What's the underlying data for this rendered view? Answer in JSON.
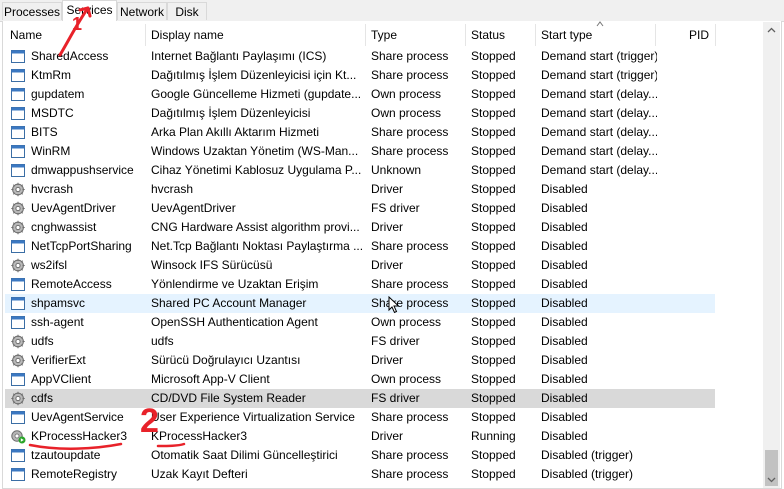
{
  "tabs": [
    {
      "label": "Processes",
      "active": false
    },
    {
      "label": "Services",
      "active": true
    },
    {
      "label": "Network",
      "active": false
    },
    {
      "label": "Disk",
      "active": false
    }
  ],
  "columns": {
    "name": "Name",
    "display_name": "Display name",
    "type": "Type",
    "status": "Status",
    "start_type": "Start type",
    "pid": "PID"
  },
  "rows": [
    {
      "icon": "service-window-icon",
      "name": "SharedAccess",
      "display": "Internet Bağlantı Paylaşımı (ICS)",
      "type": "Share process",
      "status": "Stopped",
      "start": "Demand start (trigger)",
      "pid": ""
    },
    {
      "icon": "service-window-icon",
      "name": "KtmRm",
      "display": "Dağıtılmış İşlem Düzenleyicisi için Kt...",
      "type": "Share process",
      "status": "Stopped",
      "start": "Demand start (trigger)",
      "pid": ""
    },
    {
      "icon": "service-window-icon",
      "name": "gupdatem",
      "display": "Google Güncelleme Hizmeti (gupdate...",
      "type": "Own process",
      "status": "Stopped",
      "start": "Demand start (delay...",
      "pid": ""
    },
    {
      "icon": "service-window-icon",
      "name": "MSDTC",
      "display": "Dağıtılmış İşlem Düzenleyicisi",
      "type": "Own process",
      "status": "Stopped",
      "start": "Demand start (delay...",
      "pid": ""
    },
    {
      "icon": "service-window-icon",
      "name": "BITS",
      "display": "Arka Plan Akıllı Aktarım Hizmeti",
      "type": "Share process",
      "status": "Stopped",
      "start": "Demand start (delay...",
      "pid": ""
    },
    {
      "icon": "service-window-icon",
      "name": "WinRM",
      "display": "Windows Uzaktan Yönetim (WS-Man...",
      "type": "Share process",
      "status": "Stopped",
      "start": "Demand start (delay...",
      "pid": ""
    },
    {
      "icon": "service-window-icon",
      "name": "dmwappushservice",
      "display": "Cihaz Yönetimi Kablosuz Uygulama P...",
      "type": "Unknown",
      "status": "Stopped",
      "start": "Demand start (delay...",
      "pid": ""
    },
    {
      "icon": "driver-gear-icon",
      "name": "hvcrash",
      "display": "hvcrash",
      "type": "Driver",
      "status": "Stopped",
      "start": "Disabled",
      "pid": ""
    },
    {
      "icon": "driver-gear-icon",
      "name": "UevAgentDriver",
      "display": "UevAgentDriver",
      "type": "FS driver",
      "status": "Stopped",
      "start": "Disabled",
      "pid": ""
    },
    {
      "icon": "driver-gear-icon",
      "name": "cnghwassist",
      "display": "CNG Hardware Assist algorithm provi...",
      "type": "Driver",
      "status": "Stopped",
      "start": "Disabled",
      "pid": ""
    },
    {
      "icon": "service-window-icon",
      "name": "NetTcpPortSharing",
      "display": "Net.Tcp Bağlantı Noktası Paylaştırma ...",
      "type": "Share process",
      "status": "Stopped",
      "start": "Disabled",
      "pid": ""
    },
    {
      "icon": "driver-gear-icon",
      "name": "ws2ifsl",
      "display": "Winsock IFS Sürücüsü",
      "type": "Driver",
      "status": "Stopped",
      "start": "Disabled",
      "pid": ""
    },
    {
      "icon": "service-window-icon",
      "name": "RemoteAccess",
      "display": "Yönlendirme ve Uzaktan Erişim",
      "type": "Share process",
      "status": "Stopped",
      "start": "Disabled",
      "pid": ""
    },
    {
      "icon": "service-window-icon",
      "name": "shpamsvc",
      "display": "Shared PC Account Manager",
      "type": "Share process",
      "status": "Stopped",
      "start": "Disabled",
      "pid": ""
    },
    {
      "icon": "service-window-icon",
      "name": "ssh-agent",
      "display": "OpenSSH Authentication Agent",
      "type": "Own process",
      "status": "Stopped",
      "start": "Disabled",
      "pid": ""
    },
    {
      "icon": "driver-gear-icon",
      "name": "udfs",
      "display": "udfs",
      "type": "FS driver",
      "status": "Stopped",
      "start": "Disabled",
      "pid": ""
    },
    {
      "icon": "driver-gear-icon",
      "name": "VerifierExt",
      "display": "Sürücü Doğrulayıcı Uzantısı",
      "type": "Driver",
      "status": "Stopped",
      "start": "Disabled",
      "pid": ""
    },
    {
      "icon": "service-window-icon",
      "name": "AppVClient",
      "display": "Microsoft App-V Client",
      "type": "Own process",
      "status": "Stopped",
      "start": "Disabled",
      "pid": ""
    },
    {
      "icon": "driver-gear-icon",
      "name": "cdfs",
      "display": "CD/DVD File System Reader",
      "type": "FS driver",
      "status": "Stopped",
      "start": "Disabled",
      "pid": ""
    },
    {
      "icon": "service-window-icon",
      "name": "UevAgentService",
      "display": "User Experience Virtualization Service",
      "type": "Share process",
      "status": "Stopped",
      "start": "Disabled",
      "pid": ""
    },
    {
      "icon": "driver-running-icon",
      "name": "KProcessHacker3",
      "display": "KProcessHacker3",
      "type": "Driver",
      "status": "Running",
      "start": "Disabled",
      "pid": ""
    },
    {
      "icon": "service-window-icon",
      "name": "tzautoupdate",
      "display": "Otomatik Saat Dilimi Güncelleştirici",
      "type": "Share process",
      "status": "Stopped",
      "start": "Disabled (trigger)",
      "pid": ""
    },
    {
      "icon": "service-window-icon",
      "name": "RemoteRegistry",
      "display": "Uzak Kayıt Defteri",
      "type": "Share process",
      "status": "Stopped",
      "start": "Disabled (trigger)",
      "pid": ""
    }
  ],
  "hover_row": "shpamsvc",
  "selected_row": "cdfs",
  "annotations": {
    "marker_1": "1",
    "marker_2": "2"
  },
  "colors": {
    "annotation_red": "#e8222a",
    "hover_blue": "#e5f3ff",
    "selected_gray": "#d9d9d9"
  }
}
